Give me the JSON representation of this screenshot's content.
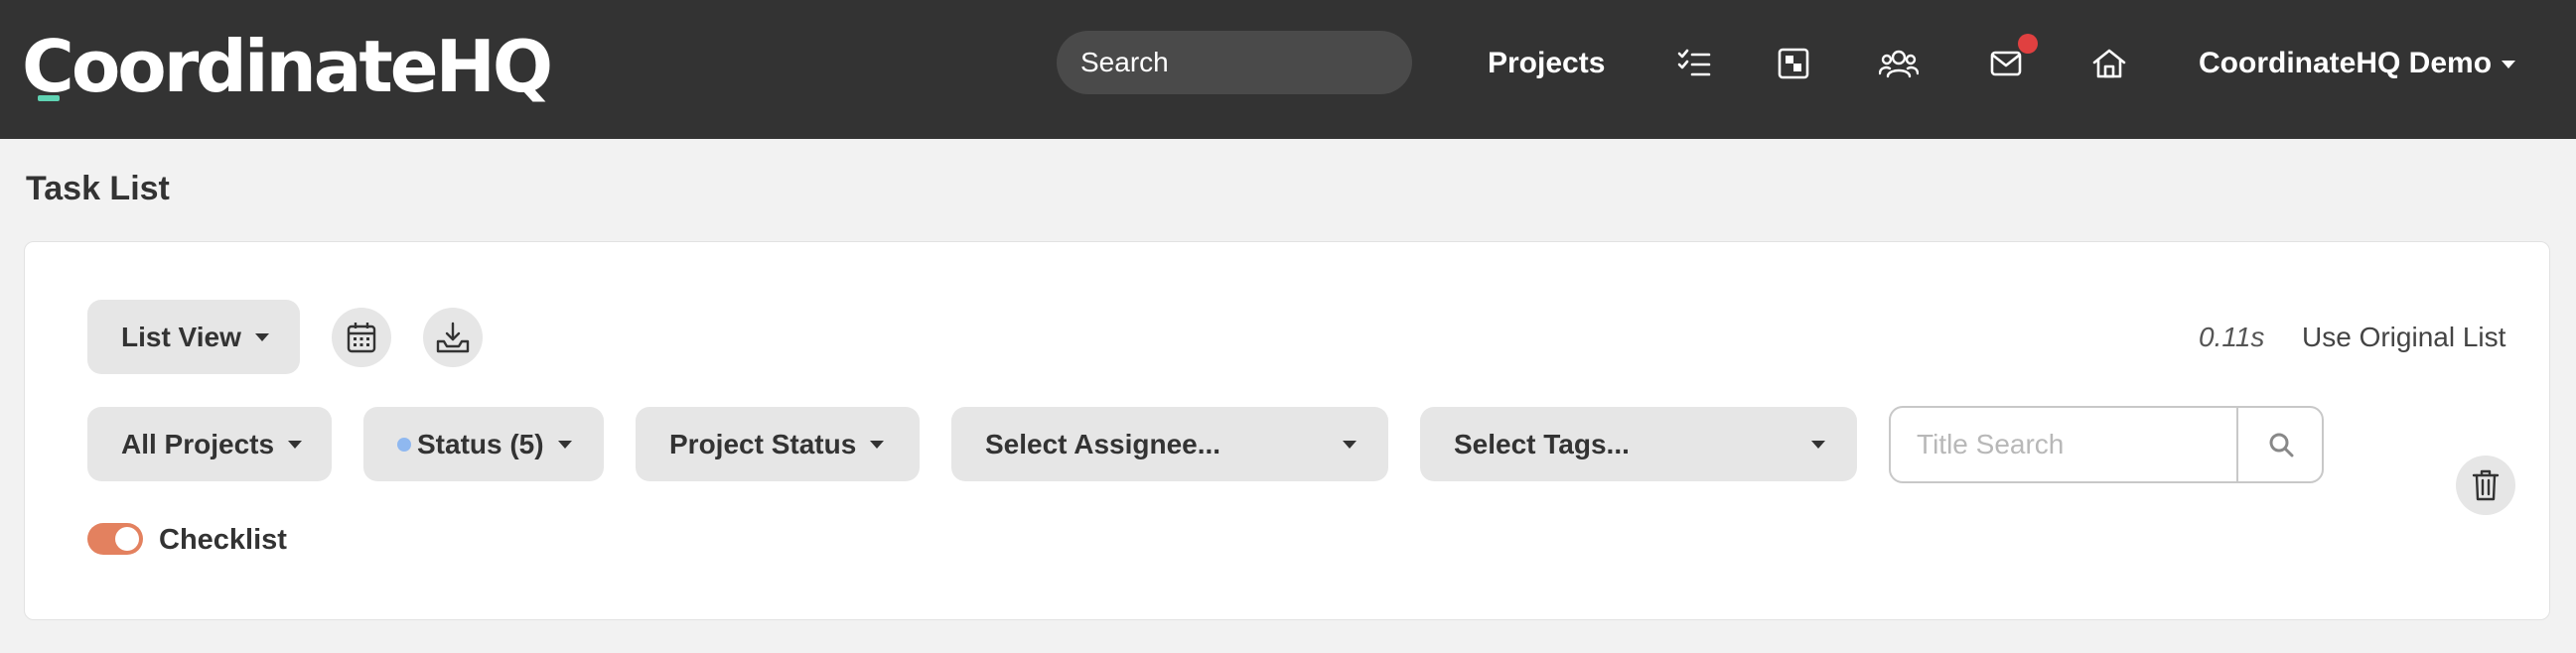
{
  "header": {
    "logo_text": "CoordinateHQ",
    "search_label": "Search",
    "nav_projects": "Projects",
    "user_menu": "CoordinateHQ Demo",
    "icons": [
      "tasks-icon",
      "board-icon",
      "team-icon",
      "mail-icon",
      "home-icon"
    ]
  },
  "page": {
    "title": "Task List"
  },
  "toolbar": {
    "view_select": "List View",
    "timing": "0.11s",
    "use_original": "Use Original List"
  },
  "filters": {
    "projects": "All Projects",
    "status": "Status (5)",
    "project_status": "Project Status",
    "assignee": "Select Assignee...",
    "tags": "Select Tags...",
    "title_search_placeholder": "Title Search"
  },
  "checklist": {
    "label": "Checklist",
    "enabled": true
  },
  "colors": {
    "header_bg": "#333333",
    "logo_accent": "#5fd3b3",
    "notification": "#e04040",
    "toggle_on": "#e3815f",
    "status_dot": "#8fb8f0"
  }
}
